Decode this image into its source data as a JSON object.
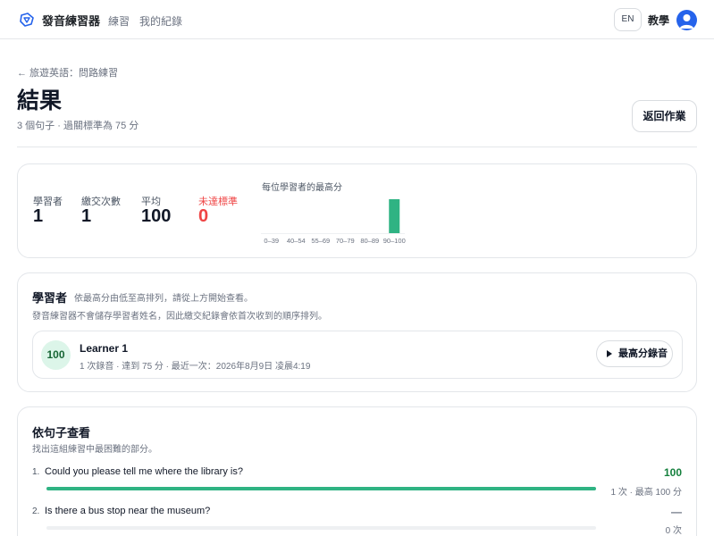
{
  "nav": {
    "brand": "發音練習器",
    "practice": "練習",
    "records": "我的紀錄",
    "lang": "EN",
    "teach": "教學",
    "accent_color": "#2563eb"
  },
  "header": {
    "breadcrumb": "← 旅遊英語：問路練習",
    "title": "結果",
    "subtitle": "3 個句子 · 過關標準為 75 分",
    "back_button": "返回作業"
  },
  "stats": {
    "learners_label": "學習者",
    "learners_value": "1",
    "submissions_label": "繳交次數",
    "submissions_value": "1",
    "average_label": "平均",
    "average_value": "100",
    "below_label": "未達標準",
    "below_value": "0",
    "below_color": "#ef4444"
  },
  "chart_data": {
    "type": "bar",
    "title": "每位學習者的最高分",
    "categories": [
      "0–39",
      "40–54",
      "55–69",
      "70–79",
      "80–89",
      "90–100"
    ],
    "values": [
      0,
      0,
      0,
      0,
      0,
      1
    ],
    "color": "#2fb383",
    "grid": false
  },
  "learners": {
    "title": "學習者",
    "hint": "依最高分由低至高排列，請從上方開始查看。",
    "note": "發音練習器不會儲存學習者姓名，因此繳交紀錄會依首次收到的順序排列。",
    "items": [
      {
        "score": "100",
        "name": "Learner 1",
        "meta": "1 次錄音 · 達到 75 分 · 最近一次：2026年8月9日 凌晨4:19",
        "play_label": "最高分錄音"
      }
    ]
  },
  "sentences": {
    "title": "依句子查看",
    "hint": "找出這組練習中最困難的部分。",
    "items": [
      {
        "num": "1.",
        "text": "Could you please tell me where the library is?",
        "score": "100",
        "progress": 1.0,
        "meta": "1 次 · 最高 100 分"
      },
      {
        "num": "2.",
        "text": "Is there a bus stop near the museum?",
        "score": "—",
        "progress": 0,
        "meta": "0 次"
      }
    ]
  }
}
